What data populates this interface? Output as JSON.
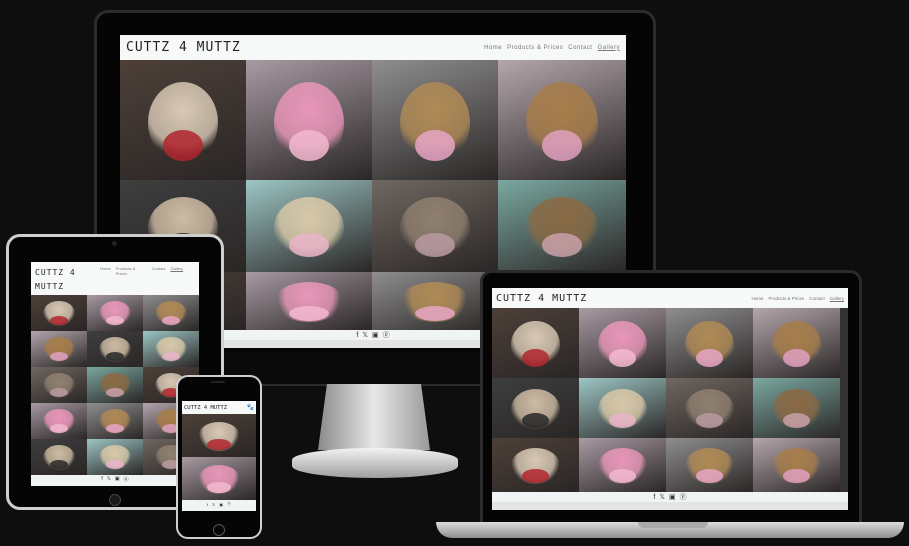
{
  "site": {
    "logo": "CUTTZ 4 MUTTZ",
    "nav": [
      {
        "label": "Home"
      },
      {
        "label": "Products & Prices"
      },
      {
        "label": "Contact"
      },
      {
        "label": "Gallery",
        "active": true
      }
    ],
    "footer_icons": [
      "facebook-icon",
      "x-icon",
      "instagram-icon",
      "pinterest-icon"
    ],
    "footer_glyphs": [
      "f",
      "𝕏",
      "▣",
      "ⓟ"
    ],
    "paw_glyph": "🐾"
  },
  "gallery": [
    {
      "name": "bulldog-bowtie",
      "bg": "#4d4038",
      "fg": "#d8c8b4",
      "accent": "#b0262e"
    },
    {
      "name": "pink-poodle",
      "bg": "#a89aa2",
      "fg": "#e896b8",
      "accent": "#f2b9cf"
    },
    {
      "name": "yorkie-pink-shirt",
      "bg": "#8f8e8e",
      "fg": "#b08a55",
      "accent": "#e7a4c4"
    },
    {
      "name": "yorkie-grooming",
      "bg": "#b4a6ab",
      "fg": "#a77d4a",
      "accent": "#e0a0c0"
    },
    {
      "name": "bulldog-sitting",
      "bg": "#3e3e3e",
      "fg": "#cdbba3",
      "accent": "#272727"
    },
    {
      "name": "terrier-salon",
      "bg": "#9cc6c4",
      "fg": "#d9c8a8",
      "accent": "#e9b4c8"
    },
    {
      "name": "salon-shelves",
      "bg": "#6f6760",
      "fg": "#8f7f6f",
      "accent": "#b99aa2"
    },
    {
      "name": "yorkie-small",
      "bg": "#7aa8a0",
      "fg": "#8a6a44",
      "accent": "#c8a0a8"
    }
  ]
}
